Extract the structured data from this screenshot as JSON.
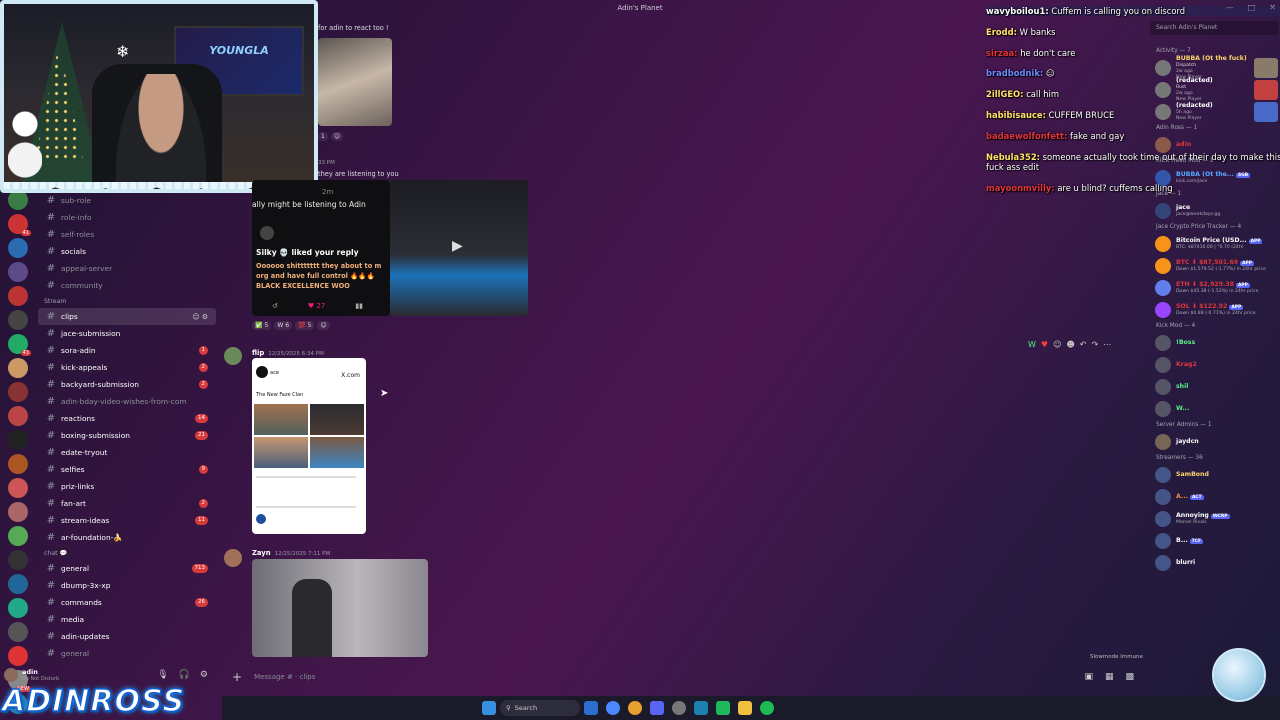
{
  "window": {
    "title": "Adin's Planet",
    "controls": [
      "—",
      "□",
      "✕"
    ]
  },
  "guild_badges": [
    {
      "value": "41"
    },
    {
      "value": "43"
    },
    {
      "value": "NEW"
    }
  ],
  "channels": {
    "items": [
      {
        "name": "sub-role",
        "style": "dim"
      },
      {
        "name": "role-info",
        "style": "dim"
      },
      {
        "name": "self-roles",
        "style": "dim"
      },
      {
        "name": "socials",
        "style": "bright"
      },
      {
        "name": "appeal-server",
        "style": "dim"
      },
      {
        "name": "community",
        "style": "dim"
      }
    ],
    "stream_category": "Stream",
    "stream_items": [
      {
        "name": "clips",
        "style": "active",
        "badge": ""
      },
      {
        "name": "jace-submission",
        "style": "bright",
        "badge": ""
      },
      {
        "name": "sora-adin",
        "style": "bright",
        "badge": "1"
      },
      {
        "name": "kick-appeals",
        "style": "bright",
        "badge": "2"
      },
      {
        "name": "backyard-submission",
        "style": "bright",
        "badge": "2"
      },
      {
        "name": "adin-bday-video-wishes-from-com",
        "style": "dim",
        "badge": ""
      },
      {
        "name": "reactions",
        "style": "bright",
        "badge": "14"
      },
      {
        "name": "boxing-submission",
        "style": "bright",
        "badge": "21"
      },
      {
        "name": "edate-tryout",
        "style": "bright",
        "badge": ""
      },
      {
        "name": "selfies",
        "style": "bright",
        "badge": "9"
      },
      {
        "name": "priz-links",
        "style": "bright",
        "badge": ""
      },
      {
        "name": "fan-art",
        "style": "bright",
        "badge": "2"
      },
      {
        "name": "stream-ideas",
        "style": "bright",
        "badge": "11"
      },
      {
        "name": "ar-foundation-🍌",
        "style": "bright",
        "badge": ""
      }
    ],
    "chat_category": "chat 💬",
    "chat_items": [
      {
        "name": "general",
        "style": "bright",
        "badge": "713"
      },
      {
        "name": "dbump-3x-xp",
        "style": "bright",
        "badge": ""
      },
      {
        "name": "commands",
        "style": "bright",
        "badge": "26"
      },
      {
        "name": "media",
        "style": "bright",
        "badge": ""
      },
      {
        "name": "adin-updates",
        "style": "bright",
        "badge": ""
      },
      {
        "name": "general",
        "style": "dim",
        "badge": ""
      }
    ]
  },
  "user": {
    "name": "adin",
    "status": "Do Not Disturb"
  },
  "overlay_logo": "ADINROSS",
  "webcam": {
    "monitor_text": "YOUNGLA"
  },
  "messages": {
    "top_caption": "for adin to react too !",
    "react_count_1": "1",
    "timestamp_partial": "33 PM",
    "quote": "they are listening to you",
    "quote_time": "2m",
    "embed_line": "ally might be listening to Adin",
    "embed_user": "Silky",
    "embed_action": "liked your reply",
    "embed_body": "Oooooo shittttttt they about to m org and have full control 🔥🔥🔥 BLACK EXCELLENCE WOO",
    "embed_likes": "27",
    "reactions_1": [
      {
        "e": "✅",
        "c": "5"
      },
      {
        "e": "W",
        "c": "6"
      },
      {
        "e": "💯",
        "c": "5"
      }
    ],
    "msg2": {
      "user": "flip",
      "time": "12/25/2025 6:34 PM",
      "post_title": "The New Faze Clan",
      "site": "X.com",
      "user_small": "ace"
    },
    "msg3": {
      "user": "Zayn",
      "time": "12/25/2025 7:11 PM"
    },
    "slowmode": "Slowmode Immune",
    "composer_placeholder": "Message # · clips"
  },
  "chat_overlay": [
    {
      "name": "wavyboilou1:",
      "color": "#ffffff",
      "text": "Cuffem is calling you on discord",
      "hl": true
    },
    {
      "name": "Erodd:",
      "color": "#ffe169",
      "text": "W banks"
    },
    {
      "name": "sirzaa:",
      "color": "#e0353b",
      "text": "he don't care"
    },
    {
      "name": "bradbodnik:",
      "color": "#6b8bff",
      "text": "😑"
    },
    {
      "name": "2illGEO:",
      "color": "#ffe169",
      "text": "call him"
    },
    {
      "name": "habibisauce:",
      "color": "#ffe169",
      "text": "CUFFEM BRUCE"
    },
    {
      "name": "badaewolfonfett:",
      "color": "#e0353b",
      "text": "fake and gay"
    },
    {
      "name": "Nebula352:",
      "color": "#ffe169",
      "text": "someone actually took time out of their day to make this fuck ass edit"
    },
    {
      "name": "mayoonmvilly:",
      "color": "#e0353b",
      "text": "are u blind? cuffems calling"
    }
  ],
  "members": {
    "search_placeholder": "Search Adin's Planet",
    "activity_header": "Activity — 7",
    "activity": [
      {
        "name": "BUBBA (Ot the fuck)",
        "game": "Dispatch",
        "sub": "2w ago",
        "tag": "New Player",
        "color": "#ffd56b",
        "thumb": "#8a7a6a"
      },
      {
        "name": "(redacted)",
        "game": "Rust",
        "sub": "2w ago",
        "tag": "New Player",
        "color": "#ffffff",
        "thumb": "#c24040"
      },
      {
        "name": "(redacted)",
        "game": "",
        "sub": "5h ago",
        "tag": "New Player",
        "color": "#ffffff",
        "thumb": "#4a6ac8"
      }
    ],
    "adin_header": "Adin Ross — 1",
    "adin": [
      {
        "name": "adin",
        "color": "#e0353b",
        "sub": ""
      }
    ],
    "kick_head_header": "KICK Head Mod — 1",
    "kick_head": [
      {
        "name": "BUBBA (Ot the...",
        "color": "#57a8ff",
        "sub": "kick.com/jace",
        "tag": "SGB"
      }
    ],
    "jace_header": "Jace — 1",
    "jace": [
      {
        "name": "jace",
        "color": "#ffffff",
        "sub": "jace@weekdays.gg"
      }
    ],
    "crypto_header": "Jace Crypto Price Tracker — 4",
    "crypto": [
      {
        "name": "Bitcoin Price (USD...",
        "color": "#ffffff",
        "sub": "BTC: $87410.00 | °0.70 (24h)",
        "tag": "APP",
        "av": "#f7931a"
      },
      {
        "name": "BTC ⬇ $87,501.69",
        "color": "#e0353b",
        "sub": "Down $1,579.52 (-1.77%) in 24hr price",
        "tag": "APP",
        "av": "#f7931a"
      },
      {
        "name": "ETH ⬇ $2,929.38",
        "color": "#e0353b",
        "sub": "Down $45.38 (-1.53%) in 24hr price",
        "tag": "APP",
        "av": "#627eea"
      },
      {
        "name": "SOL ⬇ $122.92",
        "color": "#e0353b",
        "sub": "Down $0.88 (-0.71%) in 24hr price",
        "tag": "APP",
        "av": "#9945ff"
      }
    ],
    "kickmod_header": "Kick Mod — 4",
    "kickmod": [
      {
        "name": "!Boss",
        "color": "#57f287"
      },
      {
        "name": "Krag2",
        "color": "#e0353b"
      },
      {
        "name": "shil",
        "color": "#57f287"
      },
      {
        "name": "W...",
        "color": "#57f287"
      }
    ],
    "admins_header": "Server Admins — 1",
    "admins": [
      {
        "name": "jaydcn",
        "color": "#ffffff"
      }
    ],
    "streamers_header": "Streamers — 36",
    "streamers": [
      {
        "name": "SamBond",
        "color": "#ffd56b",
        "sub": "",
        "tag": ""
      },
      {
        "name": "A...",
        "color": "#ff8a3a",
        "sub": "",
        "tag": "ACT"
      },
      {
        "name": "Annoying",
        "color": "#ffffff",
        "sub": "Marvel Rivals",
        "tag": "WCRP"
      },
      {
        "name": "B...",
        "color": "#ffffff",
        "sub": "",
        "tag": "TCF"
      },
      {
        "name": "blurri",
        "color": "#ffffff",
        "sub": "",
        "tag": ""
      }
    ]
  },
  "taskbar": {
    "search": "Search"
  }
}
